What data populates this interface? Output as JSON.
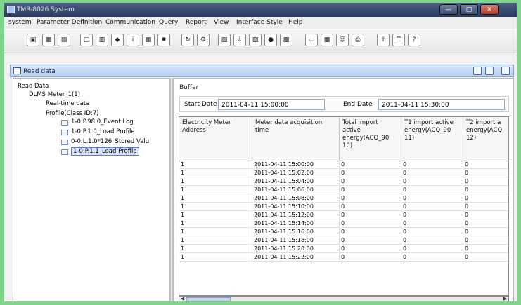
{
  "window": {
    "title": "TMR-8026 System",
    "buttons": [
      "—",
      "□",
      "✕"
    ]
  },
  "menu": [
    "system",
    "Parameter Definition",
    "Communication",
    "Query",
    "Report",
    "View",
    "Interface Style",
    "Help"
  ],
  "toolbar": {
    "icons": [
      "meter-icon",
      "table-icon",
      "grid-icon",
      "document-icon",
      "chart-icon",
      "plug-icon",
      "info-icon",
      "calendar-icon",
      "gear-icon",
      "refresh-icon",
      "settings-icon",
      "database-icon",
      "export-icon",
      "image-icon",
      "record-icon",
      "book-icon",
      "folder-icon",
      "table-icon",
      "user-icon",
      "print-icon",
      "upload-icon",
      "list-icon",
      "help-icon"
    ]
  },
  "panel": {
    "title": "Read data",
    "header_buttons": [
      "restore-icon",
      "pin-icon",
      "close-icon"
    ]
  },
  "tree": [
    {
      "label": "Read Data",
      "level": 0,
      "selected": false
    },
    {
      "label": "DLMS Meter_1(1)",
      "level": 1,
      "selected": false
    },
    {
      "label": "Real-time data",
      "level": 2,
      "selected": false
    },
    {
      "label": "Profile(Class ID:7)",
      "level": 2,
      "selected": false
    },
    {
      "label": "1-0:P.98.0_Event Log",
      "level": 3,
      "selected": false
    },
    {
      "label": "1-0:P.1.0_Load Profile",
      "level": 3,
      "selected": false
    },
    {
      "label": "0-0:L.1.0*126_Stored Valu",
      "level": 3,
      "selected": false
    },
    {
      "label": "1-0:P.1.1_Load Profile",
      "level": 3,
      "selected": true
    }
  ],
  "buffer": {
    "title": "Buffer",
    "start_date_label": "Start Date",
    "start_date_value": "2011-04-11 15:00:00",
    "end_date_label": "End Date",
    "end_date_value": "2011-04-11 15:30:00"
  },
  "table": {
    "headers": [
      "Electricity Meter Address",
      "Meter data acquisition time",
      "Total import active energy(ACQ_90 10)",
      "T1 import active energy(ACQ_90 11)",
      "T2 import a energy(ACQ 12)"
    ],
    "rows": [
      [
        "1",
        "2011-04-11 15:00:00",
        "0",
        "0",
        "0"
      ],
      [
        "1",
        "2011-04-11 15:02:00",
        "0",
        "0",
        "0"
      ],
      [
        "1",
        "2011-04-11 15:04:00",
        "0",
        "0",
        "0"
      ],
      [
        "1",
        "2011-04-11 15:06:00",
        "0",
        "0",
        "0"
      ],
      [
        "1",
        "2011-04-11 15:08:00",
        "0",
        "0",
        "0"
      ],
      [
        "1",
        "2011-04-11 15:10:00",
        "0",
        "0",
        "0"
      ],
      [
        "1",
        "2011-04-11 15:12:00",
        "0",
        "0",
        "0"
      ],
      [
        "1",
        "2011-04-11 15:14:00",
        "0",
        "0",
        "0"
      ],
      [
        "1",
        "2011-04-11 15:16:00",
        "0",
        "0",
        "0"
      ],
      [
        "1",
        "2011-04-11 15:18:00",
        "0",
        "0",
        "0"
      ],
      [
        "1",
        "2011-04-11 15:20:00",
        "0",
        "0",
        "0"
      ],
      [
        "1",
        "2011-04-11 15:22:00",
        "0",
        "0",
        "0"
      ]
    ]
  }
}
